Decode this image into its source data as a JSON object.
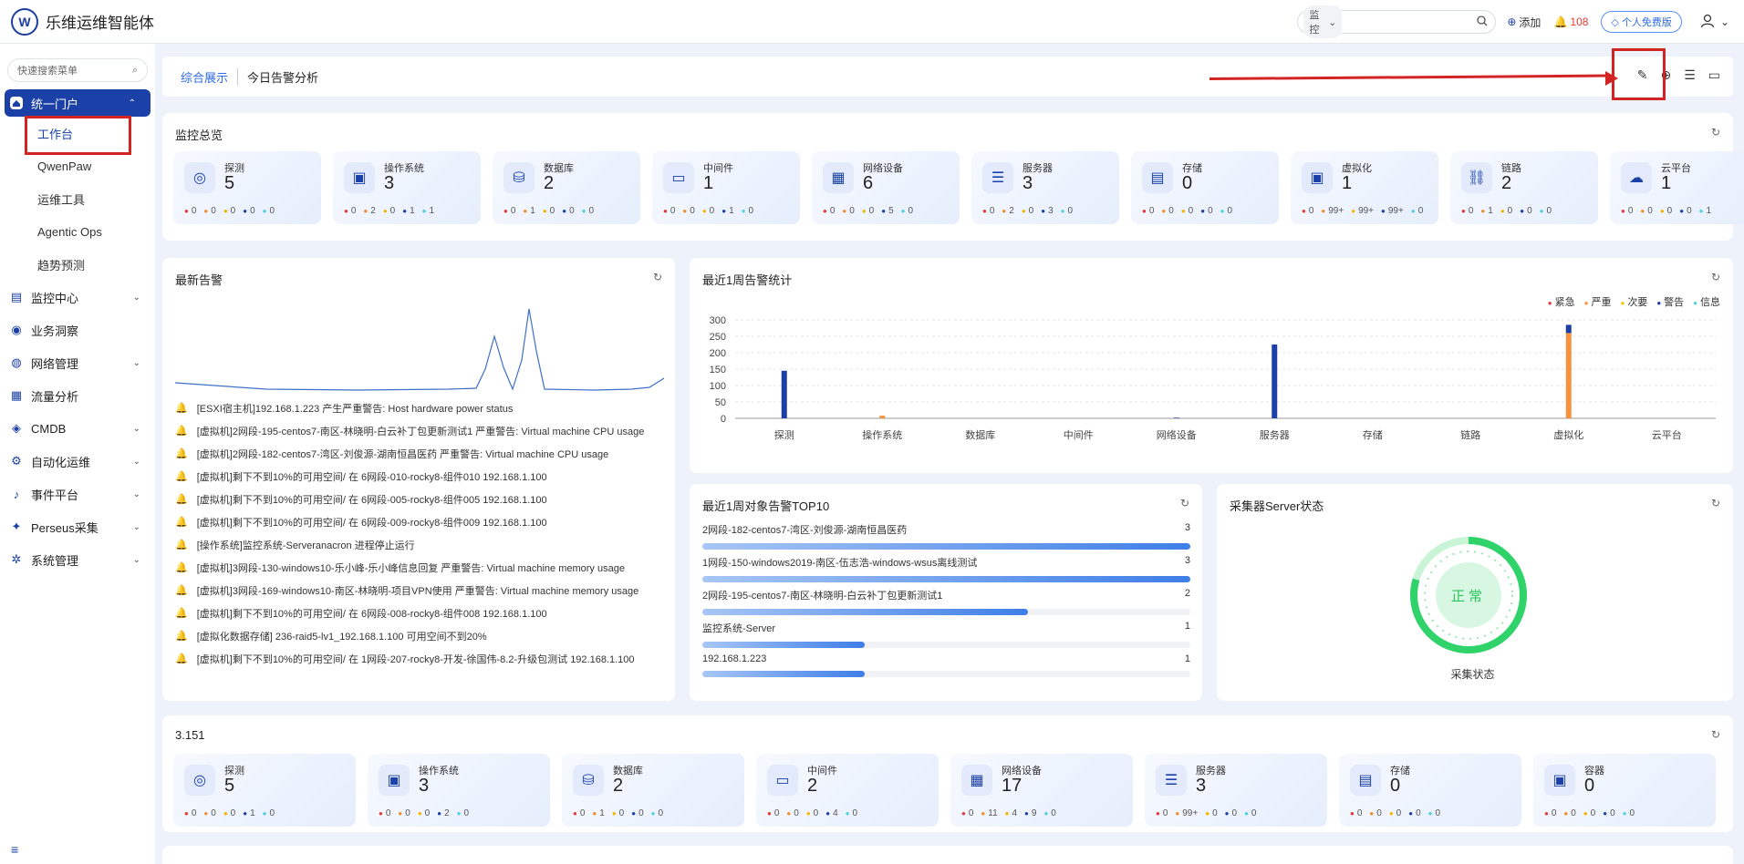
{
  "app": {
    "logo_letter": "W",
    "title": "乐维运维智能体"
  },
  "topbar": {
    "search_select": "监控",
    "search_placeholder": "",
    "add_label": "添加",
    "alert_count": "108",
    "edition_label": "个人免费版"
  },
  "sidebar": {
    "search_placeholder": "快速搜索菜单",
    "items": [
      {
        "label": "统一门户",
        "icon": "home-icon",
        "expanded": true,
        "active": true
      },
      {
        "label": "监控中心",
        "icon": "monitor-icon"
      },
      {
        "label": "业务洞察",
        "icon": "insight-icon"
      },
      {
        "label": "网络管理",
        "icon": "globe-icon"
      },
      {
        "label": "流量分析",
        "icon": "chart-icon"
      },
      {
        "label": "CMDB",
        "icon": "cube-icon"
      },
      {
        "label": "自动化运维",
        "icon": "gear-icon"
      },
      {
        "label": "事件平台",
        "icon": "bell-icon"
      },
      {
        "label": "Perseus采集",
        "icon": "network-icon"
      },
      {
        "label": "系统管理",
        "icon": "settings-icon"
      }
    ],
    "sub_items": [
      "工作台",
      "QwenPaw",
      "运维工具",
      "Agentic Ops",
      "趋势预测"
    ]
  },
  "tabs": {
    "items": [
      "综合展示",
      "今日告警分析"
    ]
  },
  "overview": {
    "title": "监控总览",
    "stats": [
      {
        "name": "探测",
        "value": "5",
        "dots": [
          "0",
          "0",
          "0",
          "0",
          "0"
        ]
      },
      {
        "name": "操作系统",
        "value": "3",
        "dots": [
          "0",
          "2",
          "0",
          "1",
          "1"
        ]
      },
      {
        "name": "数据库",
        "value": "2",
        "dots": [
          "0",
          "1",
          "0",
          "0",
          "0"
        ]
      },
      {
        "name": "中间件",
        "value": "1",
        "dots": [
          "0",
          "0",
          "0",
          "1",
          "0"
        ]
      },
      {
        "name": "网络设备",
        "value": "6",
        "dots": [
          "0",
          "0",
          "0",
          "5",
          "0"
        ]
      },
      {
        "name": "服务器",
        "value": "3",
        "dots": [
          "0",
          "2",
          "0",
          "3",
          "0"
        ]
      },
      {
        "name": "存储",
        "value": "0",
        "dots": [
          "0",
          "0",
          "0",
          "0",
          "0"
        ]
      },
      {
        "name": "虚拟化",
        "value": "1",
        "dots": [
          "0",
          "99+",
          "99+",
          "99+",
          "0"
        ]
      },
      {
        "name": "链路",
        "value": "2",
        "dots": [
          "0",
          "1",
          "0",
          "0",
          "0"
        ]
      },
      {
        "name": "云平台",
        "value": "1",
        "dots": [
          "0",
          "0",
          "0",
          "0",
          "1"
        ]
      }
    ]
  },
  "latest_alerts": {
    "title": "最新告警",
    "items": [
      "[ESXI宿主机]192.168.1.223 产生严重警告: Host hardware power status",
      "[虚拟机]2网段-195-centos7-南区-林晓明-白云补丁包更新测试1 严重警告: Virtual machine CPU usage",
      "[虚拟机]2网段-182-centos7-湾区-刘俊源-湖南恒昌医药 严重警告: Virtual machine CPU usage",
      "[虚拟机]剩下不到10%的可用空间/ 在 6网段-010-rocky8-组件010 192.168.1.100",
      "[虚拟机]剩下不到10%的可用空间/ 在 6网段-005-rocky8-组件005 192.168.1.100",
      "[虚拟机]剩下不到10%的可用空间/ 在 6网段-009-rocky8-组件009 192.168.1.100",
      "[操作系统]监控系统-Serveranacron 进程停止运行",
      "[虚拟机]3网段-130-windows10-乐小峰-乐小峰信息回复 严重警告: Virtual machine memory usage",
      "[虚拟机]3网段-169-windows10-南区-林晓明-项目VPN使用 严重警告: Virtual machine memory usage",
      "[虚拟机]剩下不到10%的可用空间/ 在 6网段-008-rocky8-组件008 192.168.1.100",
      "[虚拟化数据存储] 236-raid5-lv1_192.168.1.100 可用空间不到20%",
      "[虚拟机]剩下不到10%的可用空间/ 在 1网段-207-rocky8-开发-徐国伟-8.2-升级包测试 192.168.1.100"
    ]
  },
  "weekly_chart": {
    "title": "最近1周告警统计",
    "chart_data": {
      "type": "bar",
      "categories": [
        "探测",
        "操作系统",
        "数据库",
        "中间件",
        "网络设备",
        "服务器",
        "存储",
        "链路",
        "虚拟化",
        "云平台"
      ],
      "series": [
        {
          "name": "紧急",
          "color": "#e53935",
          "values": [
            0,
            0,
            0,
            0,
            0,
            0,
            0,
            0,
            0,
            0
          ]
        },
        {
          "name": "严重",
          "color": "#f5923e",
          "values": [
            0,
            8,
            0,
            0,
            0,
            0,
            0,
            0,
            260,
            0
          ]
        },
        {
          "name": "次要",
          "color": "#f5c400",
          "values": [
            0,
            0,
            0,
            0,
            0,
            0,
            0,
            0,
            0,
            0
          ]
        },
        {
          "name": "警告",
          "color": "#1b3fa6",
          "values": [
            145,
            0,
            0,
            0,
            2,
            225,
            0,
            0,
            25,
            0
          ]
        },
        {
          "name": "信息",
          "color": "#4dd0e1",
          "values": [
            0,
            0,
            0,
            0,
            0,
            0,
            0,
            0,
            0,
            0
          ]
        }
      ],
      "yticks": [
        0,
        50,
        100,
        150,
        200,
        250,
        300
      ],
      "ylim": [
        0,
        300
      ],
      "legend": "top-right"
    }
  },
  "top10": {
    "title": "最近1周对象告警TOP10",
    "items": [
      {
        "name": "2网段-182-centos7-湾区-刘俊源-湖南恒昌医药",
        "count": "3",
        "ratio": 1.0
      },
      {
        "name": "1网段-150-windows2019-南区-伍志浩-windows-wsus离线测试",
        "count": "3",
        "ratio": 1.0
      },
      {
        "name": "2网段-195-centos7-南区-林晓明-白云补丁包更新测试1",
        "count": "2",
        "ratio": 0.667
      },
      {
        "name": "监控系统-Server",
        "count": "1",
        "ratio": 0.333
      },
      {
        "name": "192.168.1.223",
        "count": "1",
        "ratio": 0.333
      }
    ]
  },
  "collector": {
    "title": "采集器Server状态",
    "status": "正常",
    "label": "采集状态"
  },
  "section2": {
    "title": "3.151",
    "stats": [
      {
        "name": "探测",
        "value": "5",
        "dots": [
          "0",
          "0",
          "0",
          "1",
          "0"
        ]
      },
      {
        "name": "操作系统",
        "value": "3",
        "dots": [
          "0",
          "0",
          "0",
          "2",
          "0"
        ]
      },
      {
        "name": "数据库",
        "value": "2",
        "dots": [
          "0",
          "1",
          "0",
          "0",
          "0"
        ]
      },
      {
        "name": "中间件",
        "value": "2",
        "dots": [
          "0",
          "0",
          "0",
          "4",
          "0"
        ]
      },
      {
        "name": "网络设备",
        "value": "17",
        "dots": [
          "0",
          "11",
          "4",
          "9",
          "0"
        ]
      },
      {
        "name": "服务器",
        "value": "3",
        "dots": [
          "0",
          "99+",
          "0",
          "0",
          "0"
        ]
      },
      {
        "name": "存储",
        "value": "0",
        "dots": [
          "0",
          "0",
          "0",
          "0",
          "0"
        ]
      },
      {
        "name": "容器",
        "value": "0",
        "dots": [
          "0",
          "0",
          "0",
          "0",
          "0"
        ]
      }
    ]
  }
}
